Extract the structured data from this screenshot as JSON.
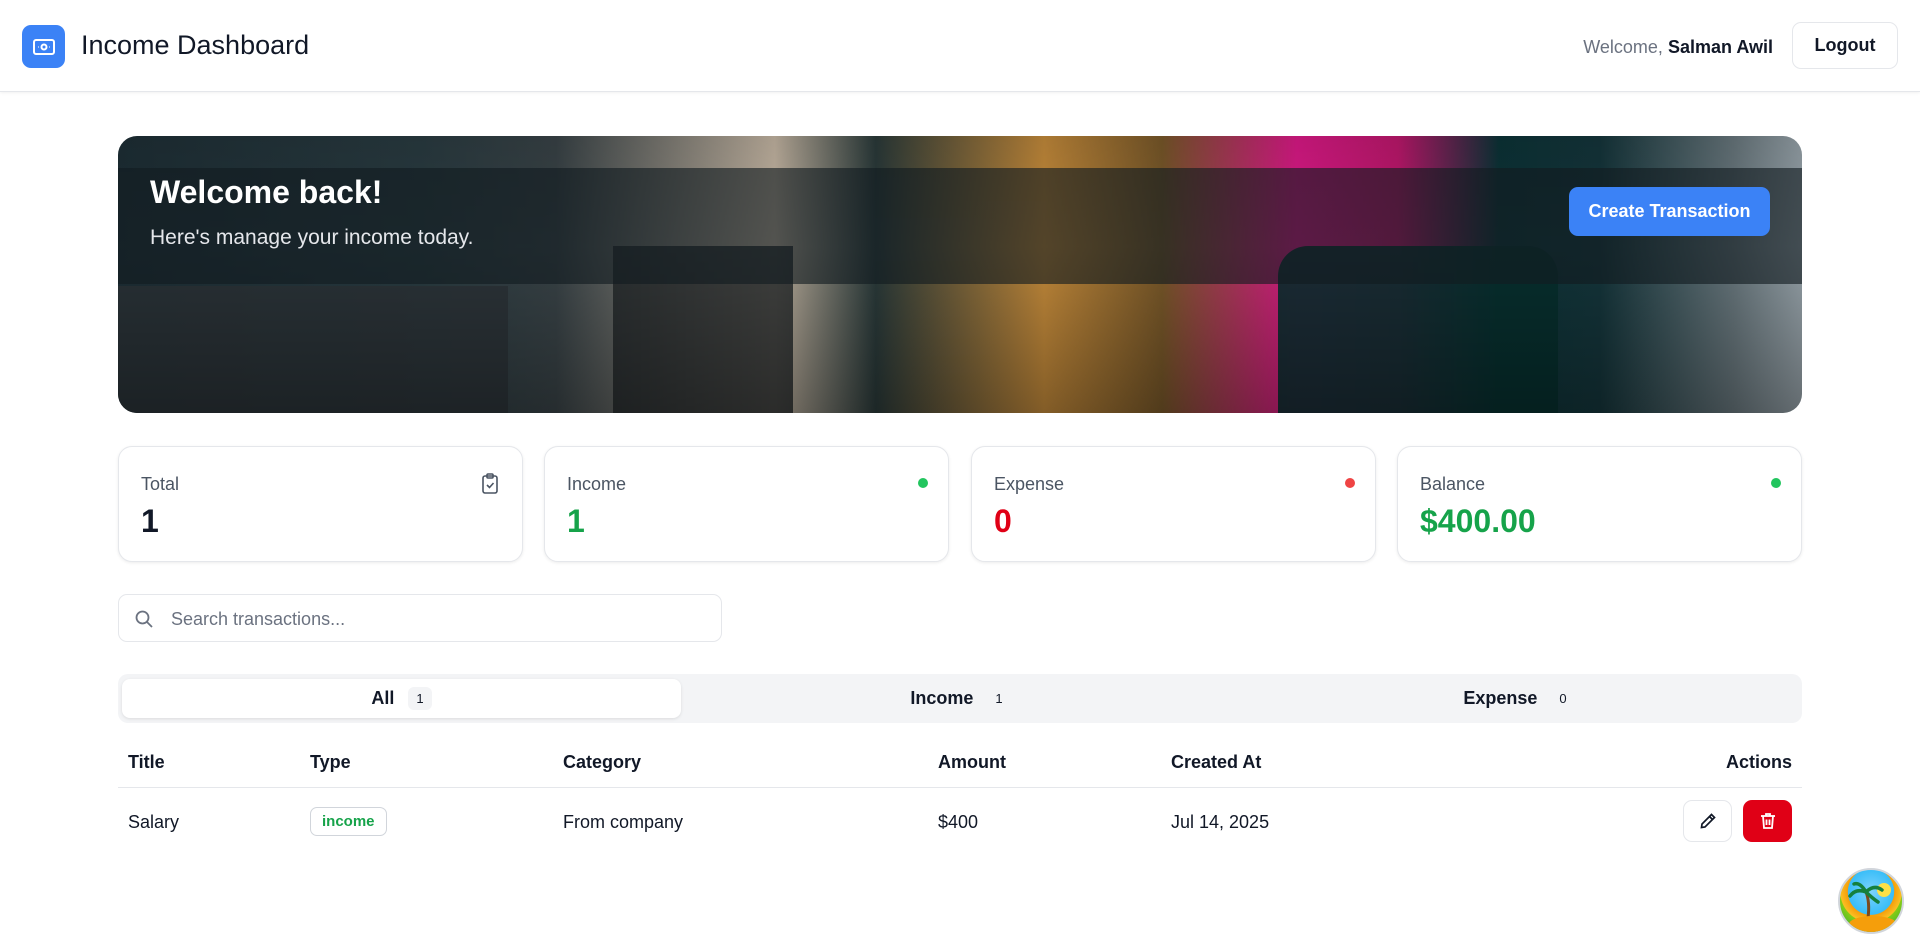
{
  "header": {
    "title": "Income Dashboard",
    "welcome_prefix": "Welcome,",
    "user_name": "Salman Awil",
    "logout_label": "Logout"
  },
  "hero": {
    "title": "Welcome back!",
    "subtitle": "Here's manage your income today.",
    "create_button_label": "Create Transaction"
  },
  "stats": [
    {
      "label": "Total",
      "value": "1",
      "indicator": "clipboard-icon",
      "color": "#111827"
    },
    {
      "label": "Income",
      "value": "1",
      "indicator": "green-dot",
      "color": "#16a34a"
    },
    {
      "label": "Expense",
      "value": "0",
      "indicator": "red-dot",
      "color": "#e00016"
    },
    {
      "label": "Balance",
      "value": "$400.00",
      "indicator": "green-dot",
      "color": "#16a34a"
    }
  ],
  "search": {
    "placeholder": "Search transactions..."
  },
  "tabs": [
    {
      "label": "All",
      "count": "1",
      "active": true
    },
    {
      "label": "Income",
      "count": "1",
      "active": false
    },
    {
      "label": "Expense",
      "count": "0",
      "active": false
    }
  ],
  "table": {
    "columns": [
      "Title",
      "Type",
      "Category",
      "Amount",
      "Created At",
      "Actions"
    ],
    "rows": [
      {
        "title": "Salary",
        "type": "income",
        "category": "From company",
        "amount": "$400",
        "created_at": "Jul 14, 2025"
      }
    ]
  },
  "colors": {
    "accent": "#3b82f6",
    "income": "#16a34a",
    "expense": "#e00016"
  }
}
